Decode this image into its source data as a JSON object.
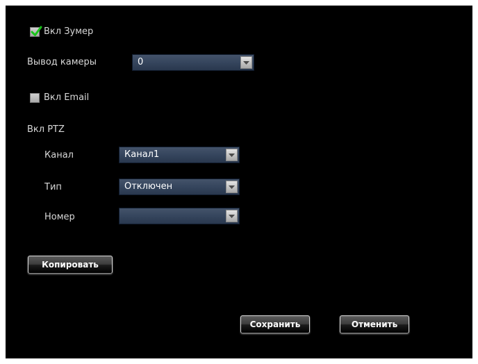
{
  "zoomer": {
    "label": "Вкл Зумер",
    "checked": true,
    "check_color": "#19c31a"
  },
  "camera_output": {
    "label": "Вывод камеры",
    "value": "0"
  },
  "email": {
    "label": "Вкл Email",
    "checked": false
  },
  "ptz": {
    "label": "Вкл PTZ",
    "channel": {
      "label": "Канал",
      "value": "Канал1"
    },
    "type": {
      "label": "Тип",
      "value": "Отключен"
    },
    "number": {
      "label": "Номер",
      "value": ""
    }
  },
  "buttons": {
    "copy": "Копировать",
    "save": "Сохранить",
    "cancel": "Отменить"
  },
  "colors": {
    "panel_background": "#000000",
    "select_background": "#34445c",
    "label_text": "#d8d8d8"
  }
}
